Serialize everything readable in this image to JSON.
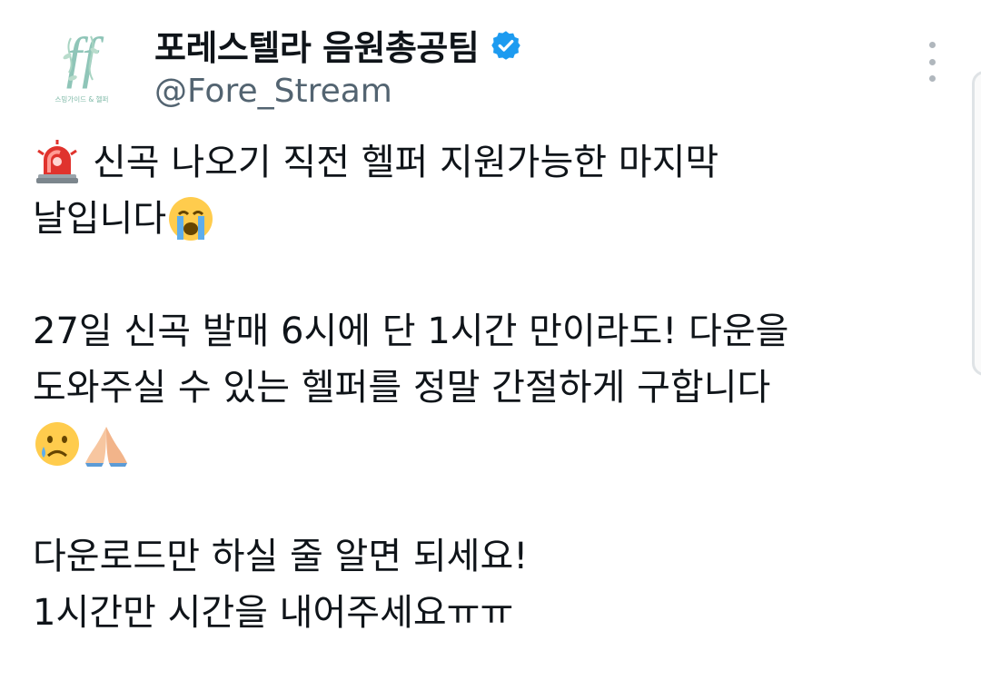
{
  "account": {
    "display_name": "포레스텔라 음원총공팀",
    "handle": "@Fore_Stream",
    "avatar_caption": "스밍가이드 & 헬퍼"
  },
  "icons": {
    "verified": "verified-badge-icon",
    "more": "more-vertical-icon",
    "siren": "police-siren-emoji",
    "crying": "loudly-crying-face-emoji",
    "sad_tear": "sad-tear-face-emoji",
    "pray": "folded-hands-emoji"
  },
  "colors": {
    "accent": "#1d9bf0",
    "secondary_text": "#536471"
  },
  "tweet": {
    "line1": "신곡 나오기 직전 헬퍼 지원가능한 마지막",
    "line2": "날입니다",
    "line3": "27일 신곡 발매 6시에 단 1시간 만이라도! 다운을",
    "line4": "도와주실 수 있는 헬퍼를 정말 간절하게 구합니다",
    "line5": "다운로드만 하실 줄 알면 되세요!",
    "line6": "1시간만 시간을 내어주세요ㅠㅠ"
  }
}
